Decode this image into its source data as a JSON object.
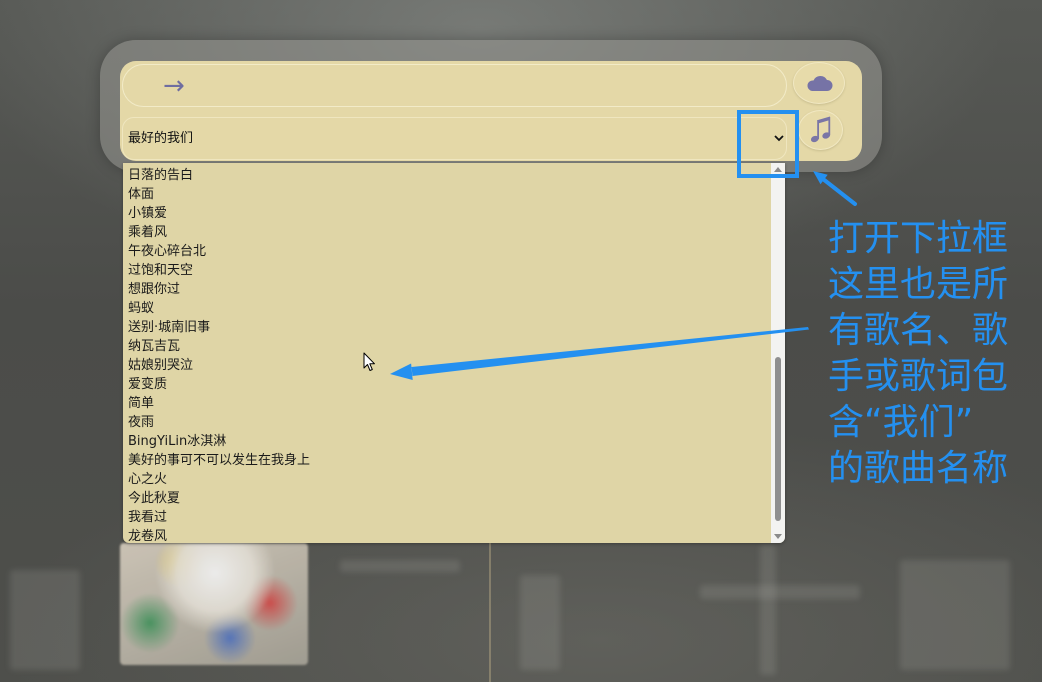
{
  "search": {
    "placeholder": "→",
    "submit_icon": "cloud-icon"
  },
  "select": {
    "selected": "最好的我们",
    "toggle_icon": "chevron-down-icon",
    "options": [
      "日落的告白",
      "体面",
      "小镇爱",
      "乘着风",
      "午夜心碎台北",
      "过饱和天空",
      "想跟你过",
      "蚂蚁",
      "送别·城南旧事",
      "纳瓦吉瓦",
      "姑娘别哭泣",
      "爱变质",
      "简单",
      "夜雨",
      "BingYiLin冰淇淋",
      "美好的事可不可以发生在我身上",
      "心之火",
      "今此秋夏",
      "我看过",
      "龙卷风"
    ]
  },
  "play_button": {
    "icon": "music-note-icon"
  },
  "annotation": {
    "lines": [
      "打开下拉框",
      "这里也是所",
      "有歌名、歌",
      "手或歌词包",
      "含“我们”",
      "的歌曲名称"
    ]
  },
  "colors": {
    "annotation_blue": "#2490f0",
    "panel_beige": "#e4d8a7",
    "list_beige": "#dfd5a6",
    "icon_purple": "#7673a6"
  }
}
